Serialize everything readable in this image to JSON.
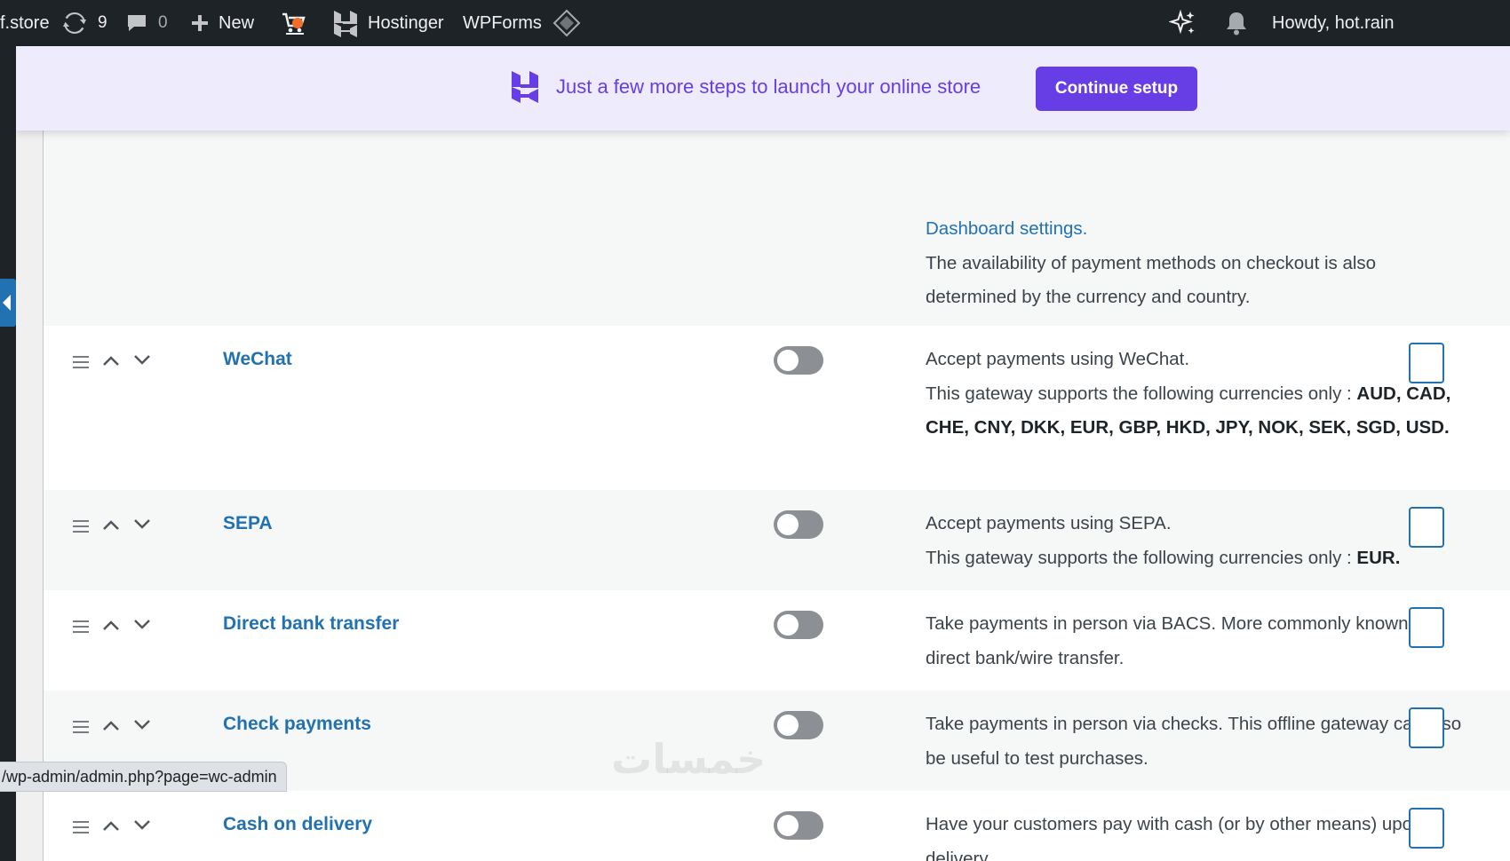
{
  "adminbar": {
    "site_name": "f.store",
    "updates_count": "9",
    "comments_count": "0",
    "new_label": "New",
    "hostinger_label": "Hostinger",
    "wpforms_label": "WPForms",
    "howdy": "Howdy, hot.rain"
  },
  "banner": {
    "text": "Just a few more steps to launch your online store",
    "button_label": "Continue setup"
  },
  "top_row": {
    "link": "Dashboard settings.",
    "text": "The availability of payment methods on checkout is also determined by the currency and country."
  },
  "payment_methods": [
    {
      "name": "WeChat",
      "enabled": false,
      "desc_line1": "Accept payments using WeChat.",
      "desc_prefix": "This gateway supports the following currencies only : ",
      "currencies": "AUD, CAD, CHE, CNY, DKK, EUR, GBP, HKD, JPY, NOK, SEK, SGD, USD."
    },
    {
      "name": "SEPA",
      "enabled": false,
      "desc_line1": "Accept payments using SEPA.",
      "desc_prefix": "This gateway supports the following currencies only : ",
      "currencies": "EUR."
    },
    {
      "name": "Direct bank transfer",
      "enabled": false,
      "description": "Take payments in person via BACS. More commonly known as direct bank/wire transfer."
    },
    {
      "name": "Check payments",
      "enabled": false,
      "description": "Take payments in person via checks. This offline gateway can also be useful to test purchases."
    },
    {
      "name": "Cash on delivery",
      "enabled": false,
      "description": "Have your customers pay with cash (or by other means) upon delivery."
    }
  ],
  "statusbar": {
    "url": "/wp-admin/admin.php?page=wc-admin"
  },
  "watermark": "خمسات",
  "colors": {
    "adminbar_bg": "#1d2327",
    "banner_bg": "#eeebfd",
    "hostinger_purple": "#673de6",
    "link_blue": "#2271b1",
    "toggle_off": "#8c8f94"
  }
}
